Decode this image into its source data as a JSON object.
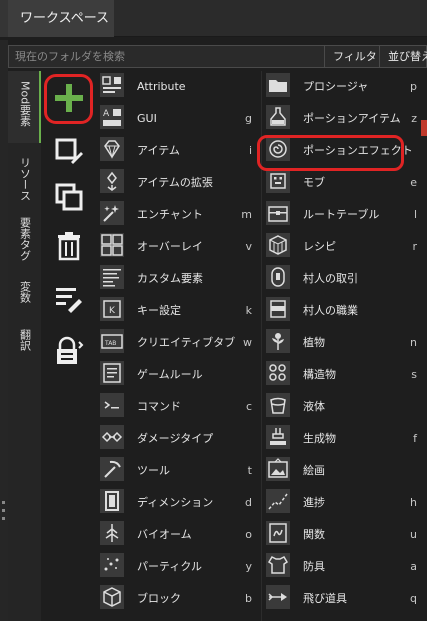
{
  "header": {
    "tab_label": "ワークスペース"
  },
  "search": {
    "placeholder": "現在のフォルダを検索",
    "filter_label": "フィルタ",
    "sort_label": "並び替え"
  },
  "vertical_tabs": [
    {
      "label": "Mod要素",
      "active": true
    },
    {
      "label": "リソース"
    },
    {
      "label": "要素タグ"
    },
    {
      "label": "変数"
    },
    {
      "label": "翻訳"
    }
  ],
  "tools": [
    {
      "name": "add",
      "icon": "plus-icon",
      "highlighted": true
    },
    {
      "name": "edit",
      "icon": "edit-icon"
    },
    {
      "name": "duplicate",
      "icon": "duplicate-icon"
    },
    {
      "name": "delete",
      "icon": "trash-icon"
    },
    {
      "name": "edit-list",
      "icon": "list-edit-icon"
    },
    {
      "name": "lock",
      "icon": "lock-icon"
    }
  ],
  "elements_left": [
    {
      "label": "Attribute",
      "key": "",
      "icon": "attribute-icon"
    },
    {
      "label": "GUI",
      "key": "g",
      "icon": "gui-icon"
    },
    {
      "label": "アイテム",
      "key": "i",
      "icon": "gem-icon"
    },
    {
      "label": "アイテムの拡張",
      "key": "",
      "icon": "item-extension-icon"
    },
    {
      "label": "エンチャント",
      "key": "m",
      "icon": "enchant-icon"
    },
    {
      "label": "オーバーレイ",
      "key": "v",
      "icon": "overlay-icon"
    },
    {
      "label": "カスタム要素",
      "key": "",
      "icon": "custom-element-icon"
    },
    {
      "label": "キー設定",
      "key": "k",
      "icon": "key-icon"
    },
    {
      "label": "クリエイティブタブ",
      "key": "w",
      "icon": "tab-icon"
    },
    {
      "label": "ゲームルール",
      "key": "",
      "icon": "gamerule-icon"
    },
    {
      "label": "コマンド",
      "key": "c",
      "icon": "command-icon"
    },
    {
      "label": "ダメージタイプ",
      "key": "",
      "icon": "damage-icon"
    },
    {
      "label": "ツール",
      "key": "t",
      "icon": "pickaxe-icon"
    },
    {
      "label": "ディメンション",
      "key": "d",
      "icon": "dimension-icon"
    },
    {
      "label": "バイオーム",
      "key": "o",
      "icon": "tree-icon"
    },
    {
      "label": "パーティクル",
      "key": "y",
      "icon": "particle-icon"
    },
    {
      "label": "ブロック",
      "key": "b",
      "icon": "cube-icon"
    }
  ],
  "elements_right": [
    {
      "label": "プロシージャ",
      "key": "p",
      "icon": "folder-icon"
    },
    {
      "label": "ポーションアイテム",
      "key": "z",
      "icon": "potion-icon"
    },
    {
      "label": "ポーションエフェクト",
      "key": "",
      "icon": "swirl-icon",
      "highlighted": true
    },
    {
      "label": "モブ",
      "key": "e",
      "icon": "mob-icon"
    },
    {
      "label": "ルートテーブル",
      "key": "l",
      "icon": "chest-icon"
    },
    {
      "label": "レシピ",
      "key": "r",
      "icon": "recipe-icon"
    },
    {
      "label": "村人の取引",
      "key": "",
      "icon": "trade-icon"
    },
    {
      "label": "村人の職業",
      "key": "",
      "icon": "profession-icon"
    },
    {
      "label": "植物",
      "key": "n",
      "icon": "plant-icon"
    },
    {
      "label": "構造物",
      "key": "s",
      "icon": "structure-icon"
    },
    {
      "label": "液体",
      "key": "",
      "icon": "bucket-icon"
    },
    {
      "label": "生成物",
      "key": "f",
      "icon": "feature-icon"
    },
    {
      "label": "絵画",
      "key": "",
      "icon": "painting-icon"
    },
    {
      "label": "進捗",
      "key": "h",
      "icon": "advancement-icon"
    },
    {
      "label": "関数",
      "key": "u",
      "icon": "function-icon"
    },
    {
      "label": "防具",
      "key": "a",
      "icon": "armor-icon"
    },
    {
      "label": "飛び道具",
      "key": "q",
      "icon": "projectile-icon"
    }
  ],
  "colors": {
    "accent_green": "#6ab04c",
    "highlight_red": "#e02424"
  }
}
